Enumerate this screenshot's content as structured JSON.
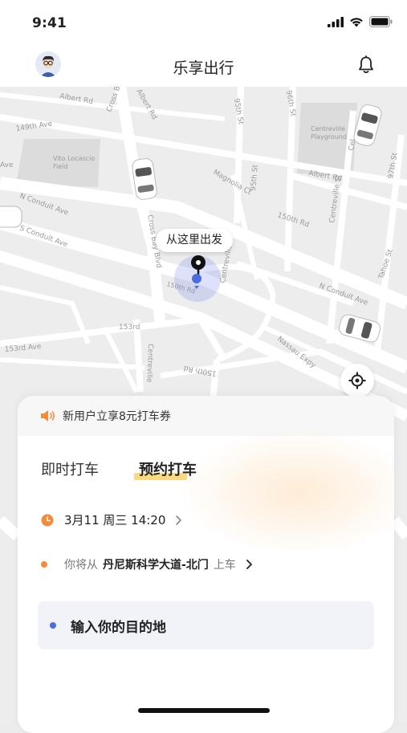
{
  "status_bar": {
    "time": "9:41"
  },
  "header": {
    "title": "乐享出行",
    "avatar": "avatar",
    "bell_icon": "bell-icon"
  },
  "map": {
    "pickup_label": "从这里出发",
    "street_labels": {
      "s149th_ave": "149th Ave",
      "albert_rd_1": "Albert Rd",
      "albert_rd_2": "Albert Rd",
      "albert_rd_3": "Albert Rd",
      "cross_bay_blvd_top": "Cross Bay Blvd",
      "cross_bay_blvd_mid": "Cross Bay Blvd",
      "st_95th": "95th St",
      "st_96th": "96th St",
      "st_97th": "97th St",
      "vito_field": "Vito Locascio\nField",
      "centreville_playground": "Centreville\nPlayground",
      "ave_left": "Ave",
      "n_conduit_ave": "N Conduit Ave",
      "s_conduit_ave": "S Conduit Ave",
      "magnolia_ct": "Magnolia Ct",
      "st_95th_lower": "95th St",
      "s150th_rd": "150th Rd",
      "centreville_st": "Centreville St",
      "s150th_rd_pin": "150th Rd",
      "centreville_mid": "Centreville",
      "n_conduit_ave_right": "N Conduit Ave",
      "tahoe_st": "Tahoe St",
      "s153rd": "153rd",
      "s153rd_ave": "153rd Ave",
      "centreville_lower": "Centreville",
      "s150th_rd_lower": "150th Rd",
      "nassau_expy": "Nassau Expy",
      "cel": "Cel"
    }
  },
  "promo": {
    "text": "新用户立享8元打车券",
    "icon": "speaker-icon"
  },
  "tabs": [
    {
      "label": "即时打车",
      "active": false
    },
    {
      "label": "预约打车",
      "active": true
    }
  ],
  "schedule": {
    "time": "3月11 周三 14:20",
    "icon": "clock-icon"
  },
  "origin": {
    "prefix": "你将从",
    "place": "丹尼斯科学大道-北门",
    "suffix": "上车"
  },
  "destination": {
    "placeholder": "输入你的目的地"
  },
  "colors": {
    "accent_orange": "#f58a3a",
    "accent_blue": "#4a6ee0",
    "tab_highlight": "#f9d36a",
    "destination_bg": "#f1f3f9"
  }
}
